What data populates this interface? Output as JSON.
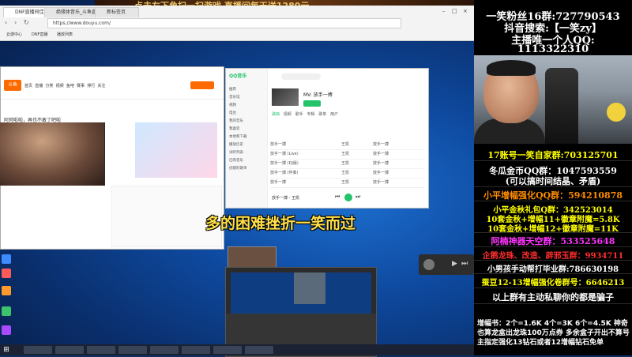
{
  "banner": {
    "text": "点击左下角扫一扫游戏  直播间每天送1280元"
  },
  "browser": {
    "tabs": [
      {
        "label": "DNF直播间佳佳5810"
      },
      {
        "label": "绝缘体音乐_斗鱼直播"
      },
      {
        "label": "新标签页"
      }
    ],
    "address": "https://www.douyu.com/",
    "bookmarks": [
      "云游中心",
      "DNF直播",
      "播放列表"
    ]
  },
  "douyu": {
    "logo": "斗鱼",
    "nav": [
      "首页",
      "直播",
      "分类",
      "视频",
      "鱼吧",
      "赛事",
      "排行",
      "关注"
    ],
    "room_title": "阿珂啦啦，再也不敢了吧啦"
  },
  "danmu": "多的困难挫折一笑而过",
  "music": {
    "app": "QQ音乐",
    "now_title": "MV: 放手一搏",
    "sidebar": [
      "推荐",
      "音乐馆",
      "视频",
      "电台",
      "我的音乐",
      "我喜欢",
      "本地和下载",
      "播放历史",
      "试听列表",
      "已购音乐",
      "创建的歌单"
    ],
    "tabs": [
      "歌曲",
      "视频",
      "歌手",
      "专辑",
      "歌单",
      "用户"
    ],
    "rows": [
      {
        "song": "放手一搏",
        "artist": "王凯",
        "album": "放手一搏"
      },
      {
        "song": "放手一搏 (Live)",
        "artist": "王凯",
        "album": "放手一搏"
      },
      {
        "song": "放手一搏 (DJ版)",
        "artist": "王凯",
        "album": "放手一搏"
      },
      {
        "song": "放手一搏 (伴奏)",
        "artist": "王凯",
        "album": "放手一搏"
      },
      {
        "song": "放手一搏",
        "artist": "王凯",
        "album": "放手一搏"
      },
      {
        "song": "放手一搏",
        "artist": "王凯",
        "album": "放手一搏"
      }
    ],
    "player_song": "放手一搏 - 王凯"
  },
  "right_panel": {
    "line1": "一笑粉丝16群:727790543",
    "line2": "抖音搜索:【一笑zy】",
    "line3": "主播唯一个人QQ:",
    "line4": "1113322310",
    "line5": "17账号一笑自家群:703125701",
    "line6": "冬瓜金币QQ群：1047593559",
    "line7": "(可以搞时间结晶、矛盾)",
    "line8": "小平增幅强化QQ群：594210878",
    "line9": "小平金秋礼包Q群：342523014",
    "line10": "10套金秋+增幅11+徽章附魔=5.8K",
    "line11": "10套金秋+增幅12+徽章附魔=11K",
    "line12": "阿楠神器天空群：533525648",
    "line13": "企鹅龙珠、改造、辟邪玉群：9934711",
    "line14": "小男孩手动帮打毕业群:786630198",
    "line15": "蚕豆12-13增幅强化卷群号：6646213",
    "line16": "以上群有主动私聊你的都是骗子",
    "bottom": "增幅书：2个=1.6K 4个=3K 6个=4.5K 神奇也算龙盒出龙珠100万点券  多余盒子开出不算号主指定强化13钻石或者12增幅钻石免单"
  },
  "colors": {
    "yellow": "#ffff00",
    "orange": "#ff8c00",
    "red": "#ff2d2d",
    "magenta": "#ff33ff",
    "white": "#ffffff",
    "green": "#23c36b"
  }
}
